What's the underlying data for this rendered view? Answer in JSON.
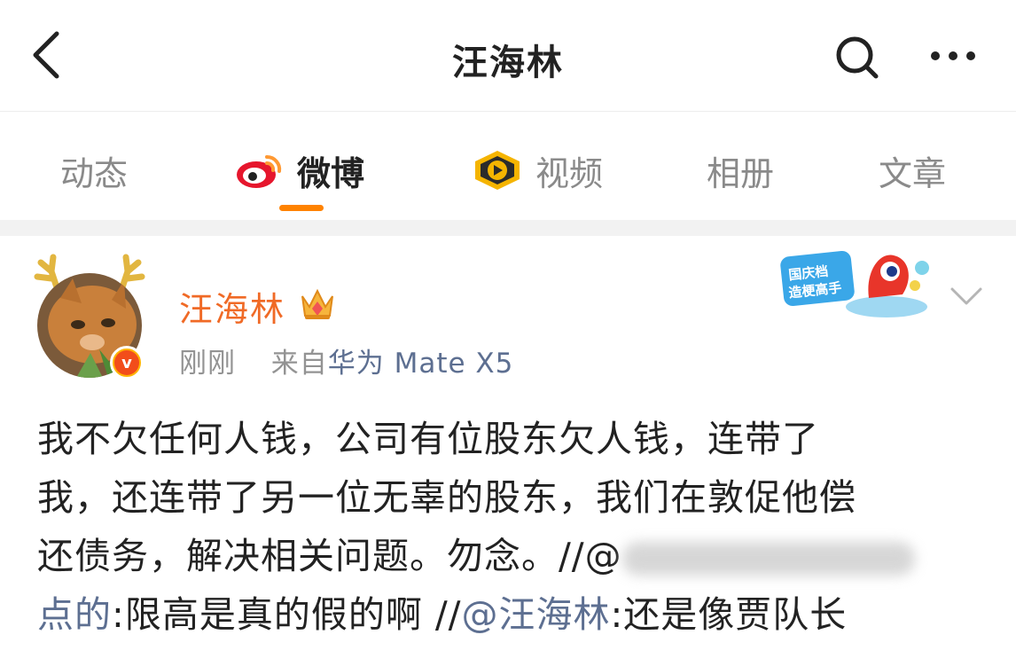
{
  "nav": {
    "title": "汪海林",
    "back_icon": "back-arrow-icon",
    "search_icon": "search-icon",
    "more_icon": "more-icon"
  },
  "tabs": [
    {
      "label": "动态",
      "active": false
    },
    {
      "label": "微博",
      "active": true,
      "icon": "weibo-logo-icon"
    },
    {
      "label": "视频",
      "active": false,
      "icon": "video-badge-icon"
    },
    {
      "label": "相册",
      "active": false
    },
    {
      "label": "文章",
      "active": false
    }
  ],
  "post": {
    "user_name": "汪海林",
    "time": "刚刚",
    "source_prefix": "来自",
    "source": "华为 Mate X5",
    "sticker_text": "国庆档造梗高手",
    "content": {
      "line1": "我不欠任何人钱，公司有位股东欠人钱，连带了",
      "line2": "我，还连带了另一位无辜的股东，我们在敦促他偿",
      "line3": "还债务，解决相关问题。勿念。//@",
      "line4_link": "点的",
      "line4_text": ":限高是真的假的啊 //",
      "line4_mention": "@汪海林",
      "line4_end": ":还是像贾队长"
    }
  },
  "colors": {
    "accent": "#ff8200",
    "username": "#f06a26",
    "link": "#5d6f91",
    "muted": "#939393"
  }
}
